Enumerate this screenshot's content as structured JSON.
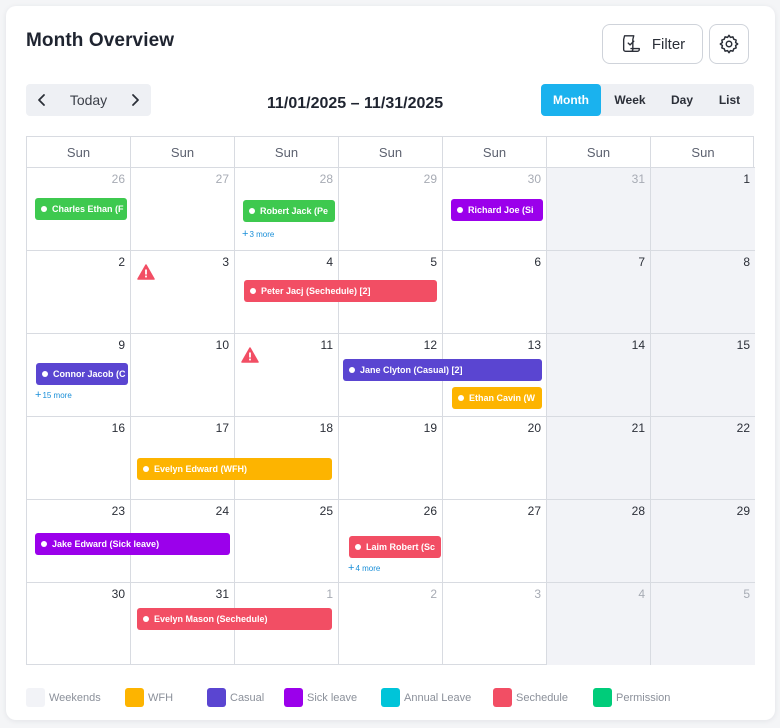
{
  "header": {
    "title": "Month Overview",
    "filter_label": "Filter",
    "settings_icon": "gear-icon",
    "filter_icon": "filter-icon"
  },
  "navigation": {
    "today_label": "Today",
    "prev_icon": "chevron-left-icon",
    "next_icon": "chevron-right-icon",
    "date_range": "11/01/2025 – 11/31/2025"
  },
  "views": {
    "month": "Month",
    "week": "Week",
    "day": "Day",
    "list": "List",
    "active": "Month"
  },
  "calendar": {
    "weekday_headers": [
      "Sun",
      "Sun",
      "Sun",
      "Sun",
      "Sun",
      "Sun",
      "Sun"
    ],
    "weeks": [
      [
        "26",
        "27",
        "28",
        "29",
        "30",
        "31",
        "1"
      ],
      [
        "2",
        "3",
        "4",
        "5",
        "6",
        "7",
        "8"
      ],
      [
        "9",
        "10",
        "11",
        "12",
        "13",
        "14",
        "15"
      ],
      [
        "16",
        "17",
        "18",
        "19",
        "20",
        "21",
        "22"
      ],
      [
        "23",
        "24",
        "25",
        "26",
        "27",
        "28",
        "29"
      ],
      [
        "30",
        "31",
        "1",
        "2",
        "3",
        "4",
        "5"
      ]
    ],
    "events": [
      {
        "label": "Charles Ethan (F",
        "type": "Permission"
      },
      {
        "label": "Robert Jack (Pe",
        "type": "Permission"
      },
      {
        "label": "Richard Joe (Si",
        "type": "Sick leave"
      },
      {
        "label": "Peter Jacj (Sechedule) [2]",
        "type": "Sechedule"
      },
      {
        "label": "Connor Jacob (C",
        "type": "Casual"
      },
      {
        "label": "Jane Clyton (Casual) [2]",
        "type": "Casual"
      },
      {
        "label": "Ethan Cavin (W",
        "type": "WFH"
      },
      {
        "label": "Evelyn Edward (WFH)",
        "type": "WFH"
      },
      {
        "label": "Jake Edward (Sick leave)",
        "type": "Sick leave"
      },
      {
        "label": "Laim Robert (Sc",
        "type": "Sechedule"
      },
      {
        "label": "Evelyn Mason (Sechedule)",
        "type": "Sechedule"
      }
    ],
    "more_links": [
      "3 more",
      "15 more",
      "4 more"
    ],
    "alert_icon": "warning-icon"
  },
  "legend": [
    {
      "label": "Weekends",
      "color": "#f2f3f7"
    },
    {
      "label": "WFH",
      "color": "#fdb400"
    },
    {
      "label": "Casual",
      "color": "#5a45d1"
    },
    {
      "label": "Sick leave",
      "color": "#9b00eb"
    },
    {
      "label": "Annual Leave",
      "color": "#00c4d9"
    },
    {
      "label": "Sechedule",
      "color": "#f24e64"
    },
    {
      "label": "Permission",
      "color": "#00cc7a"
    }
  ],
  "colors": {
    "accent": "#1ab2ee",
    "permission_event": "#3ec94f",
    "wfh": "#fdb400",
    "casual": "#5a45d1",
    "sick_leave": "#9b00eb",
    "sechedule": "#f24e64",
    "alert": "#f24e64"
  }
}
